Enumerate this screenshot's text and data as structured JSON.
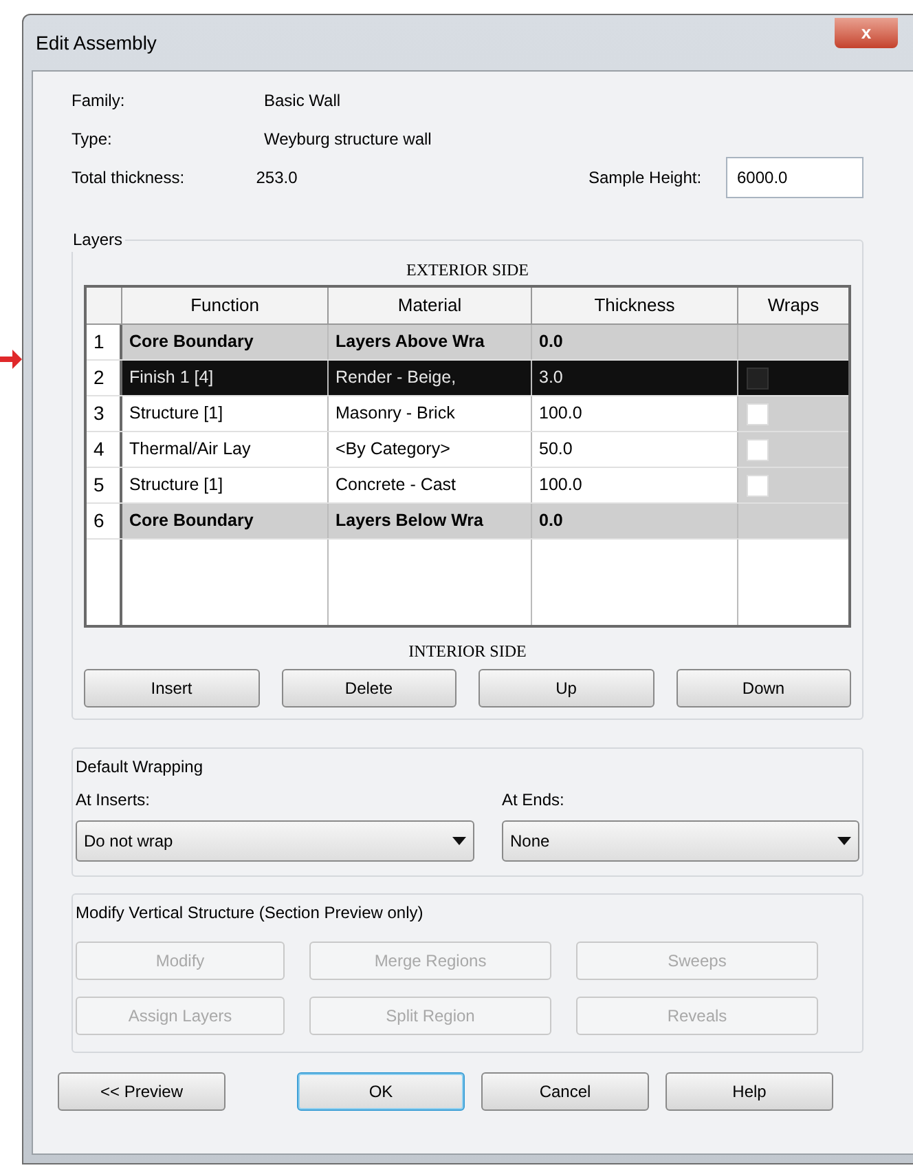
{
  "window": {
    "title": "Edit Assembly",
    "close_label": "x"
  },
  "properties": [
    {
      "label": "Family:",
      "value": "Basic Wall"
    },
    {
      "label": "Type:",
      "value": "Weyburg structure wall"
    },
    {
      "label": "Total thickness:",
      "value": "253.0"
    }
  ],
  "sample_height": {
    "label": "Sample Height:",
    "value": "6000.0"
  },
  "layers": {
    "title": "Layers",
    "top_caption": "EXTERIOR SIDE",
    "bottom_caption": "INTERIOR SIDE",
    "columns": [
      "Function",
      "Material",
      "Thickness",
      "Wraps"
    ],
    "rows": [
      {
        "number": "1",
        "kind": "boundary",
        "function": "Core Boundary",
        "material": "Layers Above Wra",
        "thickness": "0.0",
        "selected": false
      },
      {
        "number": "2",
        "kind": "layer",
        "function": "Finish 1 [4]",
        "material": "Render - Beige,",
        "thickness": "3.0",
        "wraps": false,
        "selected": true
      },
      {
        "number": "3",
        "kind": "layer",
        "function": "Structure [1]",
        "material": "Masonry - Brick",
        "thickness": "100.0",
        "wraps": false,
        "selected": false
      },
      {
        "number": "4",
        "kind": "layer",
        "function": "Thermal/Air Lay",
        "material": "<By Category>",
        "thickness": "50.0",
        "wraps": false,
        "selected": false
      },
      {
        "number": "5",
        "kind": "layer",
        "function": "Structure [1]",
        "material": "Concrete - Cast",
        "thickness": "100.0",
        "wraps": false,
        "selected": false
      },
      {
        "number": "6",
        "kind": "boundary",
        "function": "Core Boundary",
        "material": "Layers Below Wra",
        "thickness": "0.0",
        "selected": false
      }
    ],
    "buttons": [
      {
        "label": "Insert",
        "disabled": false
      },
      {
        "label": "Delete",
        "disabled": false
      },
      {
        "label": "Up",
        "disabled": false
      },
      {
        "label": "Down",
        "disabled": false
      }
    ]
  },
  "default_wrapping": {
    "title": "Default Wrapping",
    "dropdowns": [
      {
        "label": "At Inserts:",
        "value": "Do not wrap"
      },
      {
        "label": "At Ends:",
        "value": "None"
      }
    ]
  },
  "vertical_structure": {
    "title": "Modify Vertical Structure (Section Preview only)",
    "buttons": [
      {
        "label": "Modify",
        "disabled": true
      },
      {
        "label": "Merge Regions",
        "disabled": true
      },
      {
        "label": "Sweeps",
        "disabled": true
      },
      {
        "label": "Assign Layers",
        "disabled": true
      },
      {
        "label": "Split Region",
        "disabled": true
      },
      {
        "label": "Reveals",
        "disabled": true
      }
    ]
  },
  "footer_buttons": [
    {
      "label": "<< Preview",
      "default": false
    },
    {
      "label": "OK",
      "default": true
    },
    {
      "label": "Cancel",
      "default": false
    },
    {
      "label": "Help",
      "default": false
    }
  ]
}
